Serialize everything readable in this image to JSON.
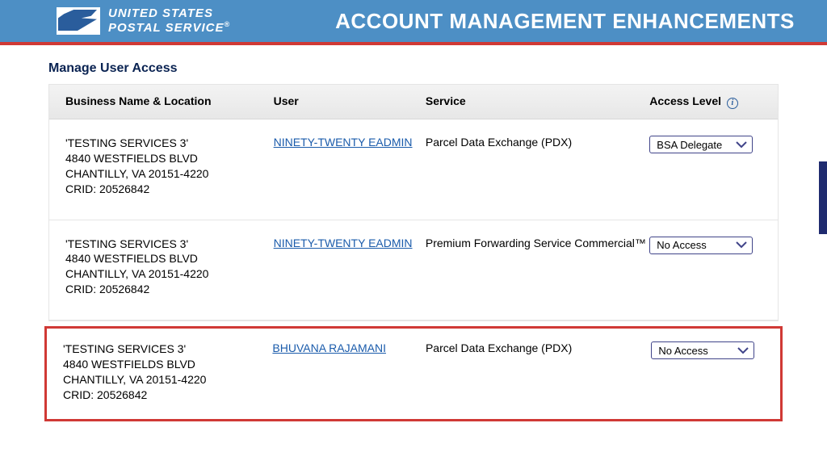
{
  "header": {
    "logo_line1": "UNITED STATES",
    "logo_line2": "POSTAL SERVICE",
    "registered": "®",
    "title": "ACCOUNT MANAGEMENT ENHANCEMENTS"
  },
  "section": {
    "title": "Manage User Access"
  },
  "columns": {
    "business": "Business Name & Location",
    "user": "User",
    "service": "Service",
    "access": "Access Level"
  },
  "info_icon_label": "i",
  "rows": [
    {
      "biz_name": "'TESTING SERVICES 3'",
      "addr1": "4840 WESTFIELDS BLVD",
      "addr2": "CHANTILLY, VA 20151-4220",
      "crid": "CRID: 20526842",
      "user": "NINETY-TWENTY EADMIN",
      "service": "Parcel Data Exchange (PDX)",
      "access": "BSA Delegate"
    },
    {
      "biz_name": "'TESTING SERVICES 3'",
      "addr1": "4840 WESTFIELDS BLVD",
      "addr2": "CHANTILLY, VA 20151-4220",
      "crid": "CRID: 20526842",
      "user": "NINETY-TWENTY EADMIN",
      "service": "Premium Forwarding Service Commercial™",
      "access": "No Access"
    },
    {
      "biz_name": "'TESTING SERVICES 3'",
      "addr1": "4840 WESTFIELDS BLVD",
      "addr2": "CHANTILLY, VA 20151-4220",
      "crid": "CRID: 20526842",
      "user": "BHUVANA RAJAMANI",
      "service": "Parcel Data Exchange (PDX)",
      "access": "No Access"
    }
  ]
}
